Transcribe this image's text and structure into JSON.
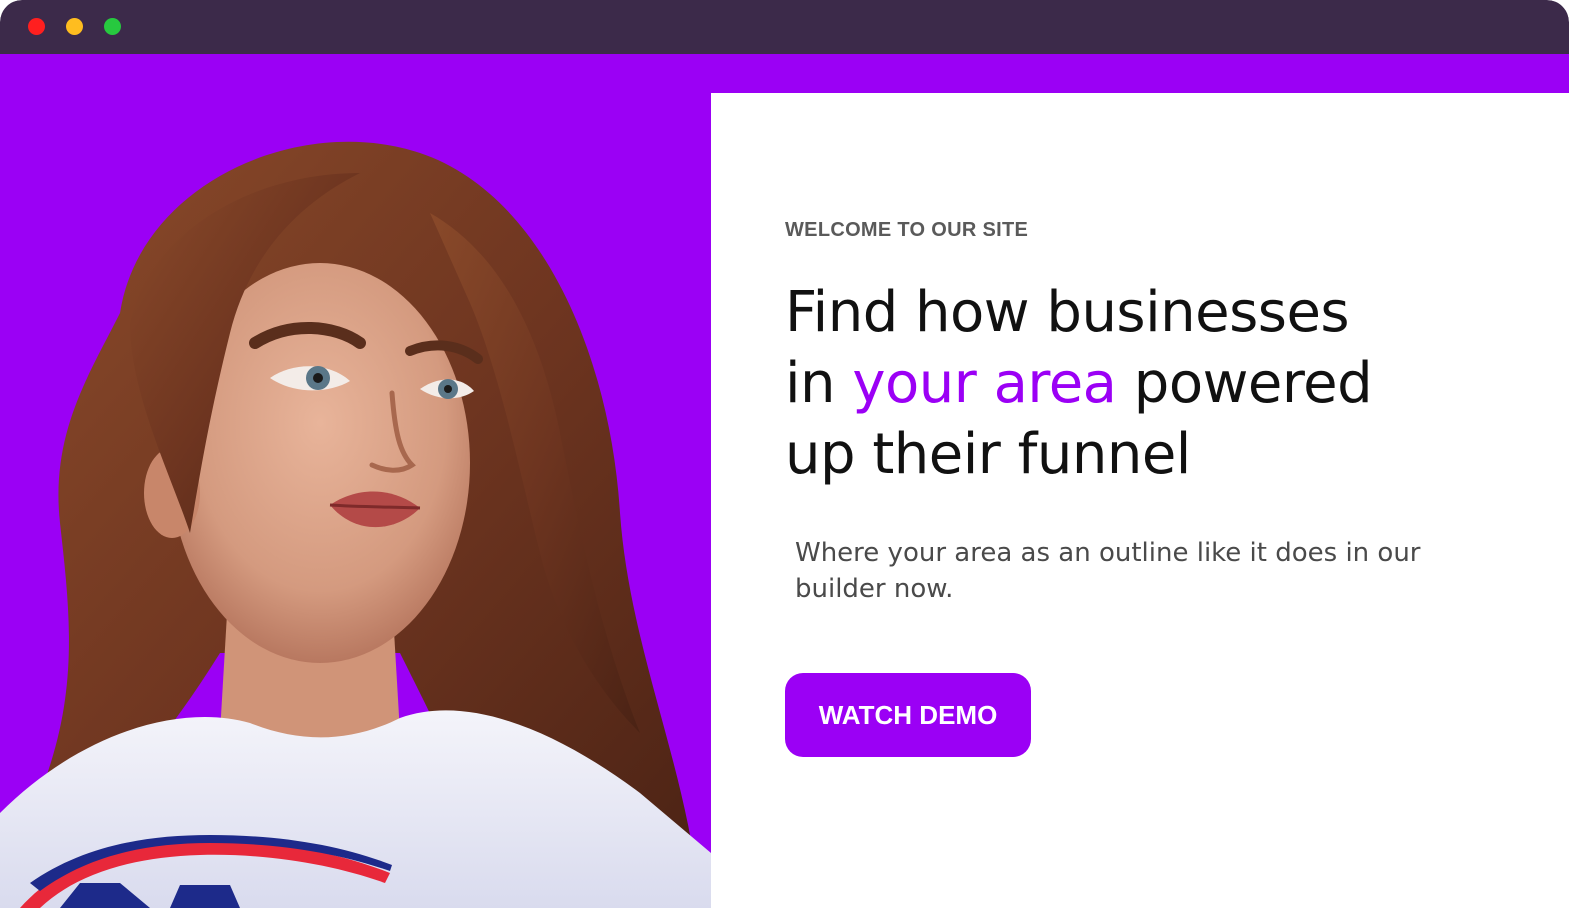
{
  "colors": {
    "brand_purple": "#9b00f5",
    "titlebar": "#3c2a4a",
    "dot_close": "#ff1f1f",
    "dot_minimize": "#ffbd1f",
    "dot_maximize": "#27c93f"
  },
  "window": {
    "controls": [
      "close-icon",
      "minimize-icon",
      "maximize-icon"
    ]
  },
  "hero": {
    "image": "woman-portrait-photo",
    "eyebrow": "WELCOME TO OUR SITE",
    "headline_line1": "Find how businesses",
    "headline_line2_before": "in ",
    "headline_accent": "your area",
    "headline_line2_after": " powered",
    "headline_line3": "up their funnel",
    "subtext": "Where your area as an outline like it does in our builder now.",
    "cta_label": "WATCH DEMO"
  }
}
